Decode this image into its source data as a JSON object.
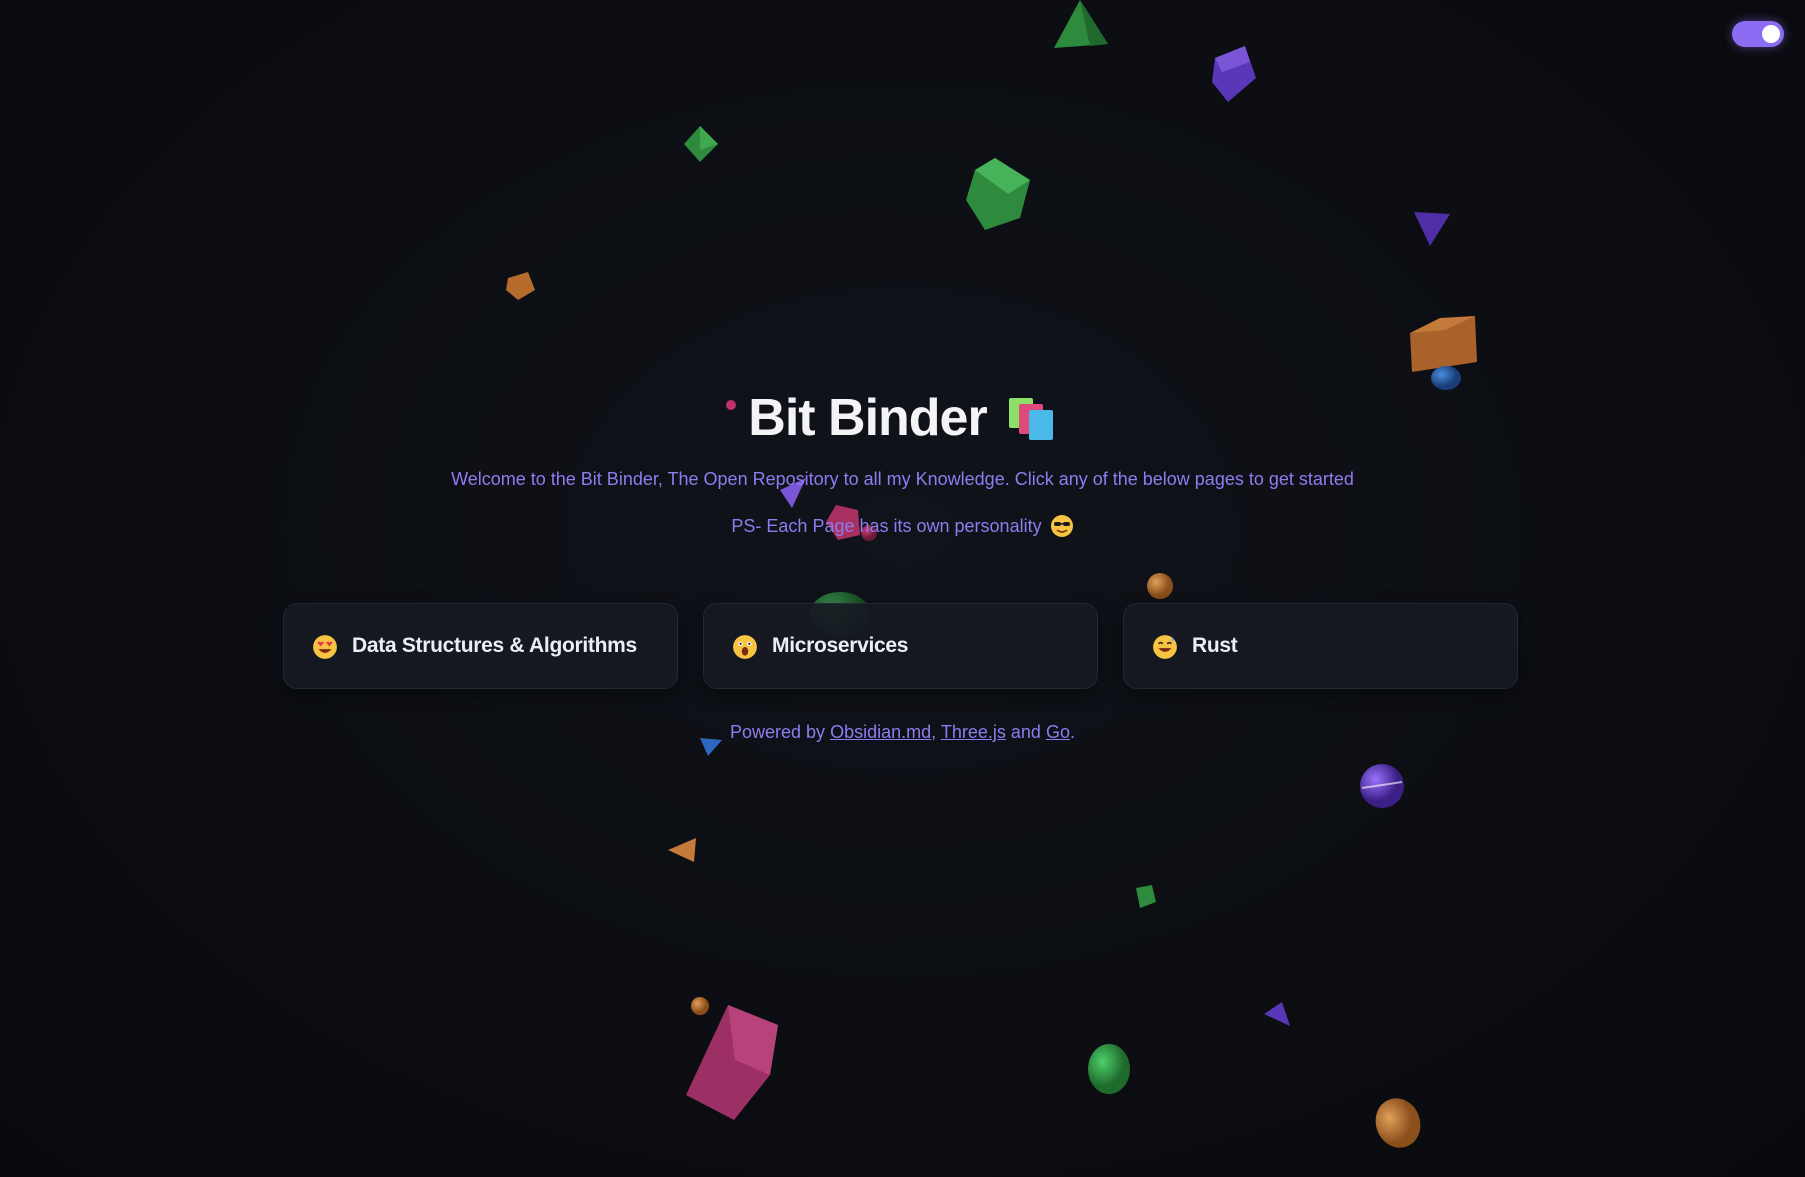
{
  "app": {
    "title": "Bit Binder",
    "accent_color": "#8b6cf2",
    "background_color": "#0c0e13"
  },
  "theme_toggle": {
    "state": "on",
    "icon": "toggle-switch-icon"
  },
  "hero": {
    "title": "Bit Binder",
    "title_icon": "books-icon",
    "subtitle": "Welcome to the Bit Binder, The Open Repository to all my Knowledge. Click any of the below pages to get started",
    "ps_text": "PS- Each Page has its own personality",
    "ps_icon": "sunglasses-face-icon"
  },
  "cards": [
    {
      "label": "Data Structures & Algorithms",
      "icon": "heart-eyes-face-icon"
    },
    {
      "label": "Microservices",
      "icon": "screaming-face-icon"
    },
    {
      "label": "Rust",
      "icon": "sweat-smile-face-icon"
    }
  ],
  "footer": {
    "prefix": "Powered by",
    "links": [
      "Obsidian.md",
      "Three.js",
      "Go"
    ],
    "sep1": ",",
    "sep2": "and",
    "suffix": "."
  }
}
